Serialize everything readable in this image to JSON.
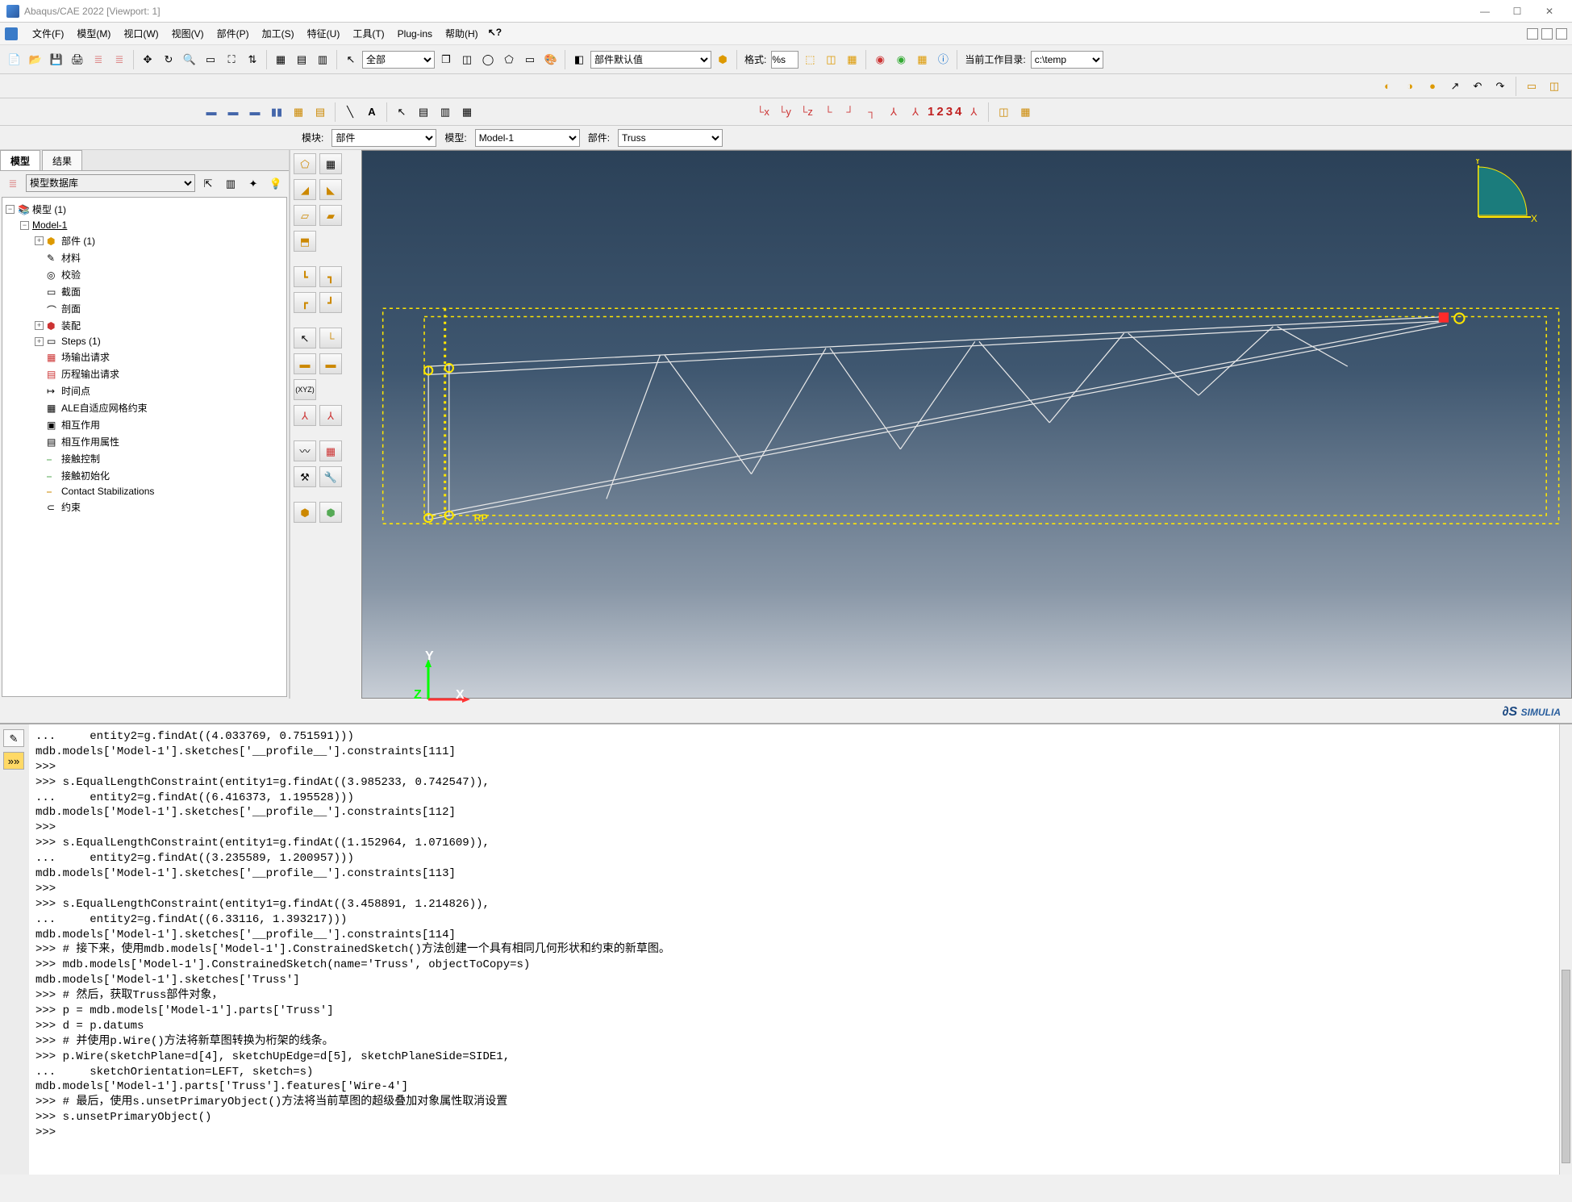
{
  "window": {
    "title": "Abaqus/CAE 2022   [Viewport: 1]"
  },
  "menu": {
    "items": [
      "文件(F)",
      "模型(M)",
      "视口(W)",
      "视图(V)",
      "部件(P)",
      "加工(S)",
      "特征(U)",
      "工具(T)",
      "Plug-ins",
      "帮助(H)"
    ]
  },
  "toolbar": {
    "format_label": "格式:",
    "format_value": "%s",
    "workdir_label": "当前工作目录:",
    "workdir_value": "c:\\temp",
    "selscope": "全部",
    "defaultset": "部件默认值"
  },
  "ctx": {
    "module_label": "模块:",
    "module_value": "部件",
    "model_label": "模型:",
    "model_value": "Model-1",
    "part_label": "部件:",
    "part_value": "Truss"
  },
  "side": {
    "tab_model": "模型",
    "tab_result": "结果",
    "db_label": "模型数据库"
  },
  "tree": {
    "root": "模型 (1)",
    "n_model1": "Model-1",
    "n_parts": "部件 (1)",
    "n_material": "材料",
    "n_calib": "校验",
    "n_section": "截面",
    "n_profile": "剖面",
    "n_assembly": "装配",
    "n_steps": "Steps (1)",
    "n_fieldout": "场输出请求",
    "n_histout": "历程输出请求",
    "n_timepts": "时间点",
    "n_ale": "ALE自适应网格约束",
    "n_interaction": "相互作用",
    "n_intprop": "相互作用属性",
    "n_contactctrl": "接触控制",
    "n_contactinit": "接触初始化",
    "n_contactstab": "Contact Stabilizations",
    "n_constraint": "约束"
  },
  "viewport": {
    "rp_label": "RP",
    "x": "X",
    "y": "Y",
    "z": "Z"
  },
  "numbers": [
    "1",
    "2",
    "3",
    "4"
  ],
  "brand": "SIMULIA",
  "console_lines": [
    "...     entity2=g.findAt((4.033769, 0.751591)))",
    "mdb.models['Model-1'].sketches['__profile__'].constraints[111]",
    ">>> ",
    ">>> s.EqualLengthConstraint(entity1=g.findAt((3.985233, 0.742547)),",
    "...     entity2=g.findAt((6.416373, 1.195528)))",
    "mdb.models['Model-1'].sketches['__profile__'].constraints[112]",
    ">>> ",
    ">>> s.EqualLengthConstraint(entity1=g.findAt((1.152964, 1.071609)),",
    "...     entity2=g.findAt((3.235589, 1.200957)))",
    "mdb.models['Model-1'].sketches['__profile__'].constraints[113]",
    ">>> ",
    ">>> s.EqualLengthConstraint(entity1=g.findAt((3.458891, 1.214826)),",
    "...     entity2=g.findAt((6.33116, 1.393217)))",
    "mdb.models['Model-1'].sketches['__profile__'].constraints[114]",
    ">>> # 接下来，使用mdb.models['Model-1'].ConstrainedSketch()方法创建一个具有相同几何形状和约束的新草图。",
    ">>> mdb.models['Model-1'].ConstrainedSketch(name='Truss', objectToCopy=s)",
    "mdb.models['Model-1'].sketches['Truss']",
    ">>> # 然后，获取Truss部件对象，",
    ">>> p = mdb.models['Model-1'].parts['Truss']",
    ">>> d = p.datums",
    ">>> # 并使用p.Wire()方法将新草图转换为桁架的线条。",
    ">>> p.Wire(sketchPlane=d[4], sketchUpEdge=d[5], sketchPlaneSide=SIDE1,",
    "...     sketchOrientation=LEFT, sketch=s)",
    "mdb.models['Model-1'].parts['Truss'].features['Wire-4']",
    ">>> # 最后，使用s.unsetPrimaryObject()方法将当前草图的超级叠加对象属性取消设置",
    ">>> s.unsetPrimaryObject()",
    ">>> "
  ]
}
